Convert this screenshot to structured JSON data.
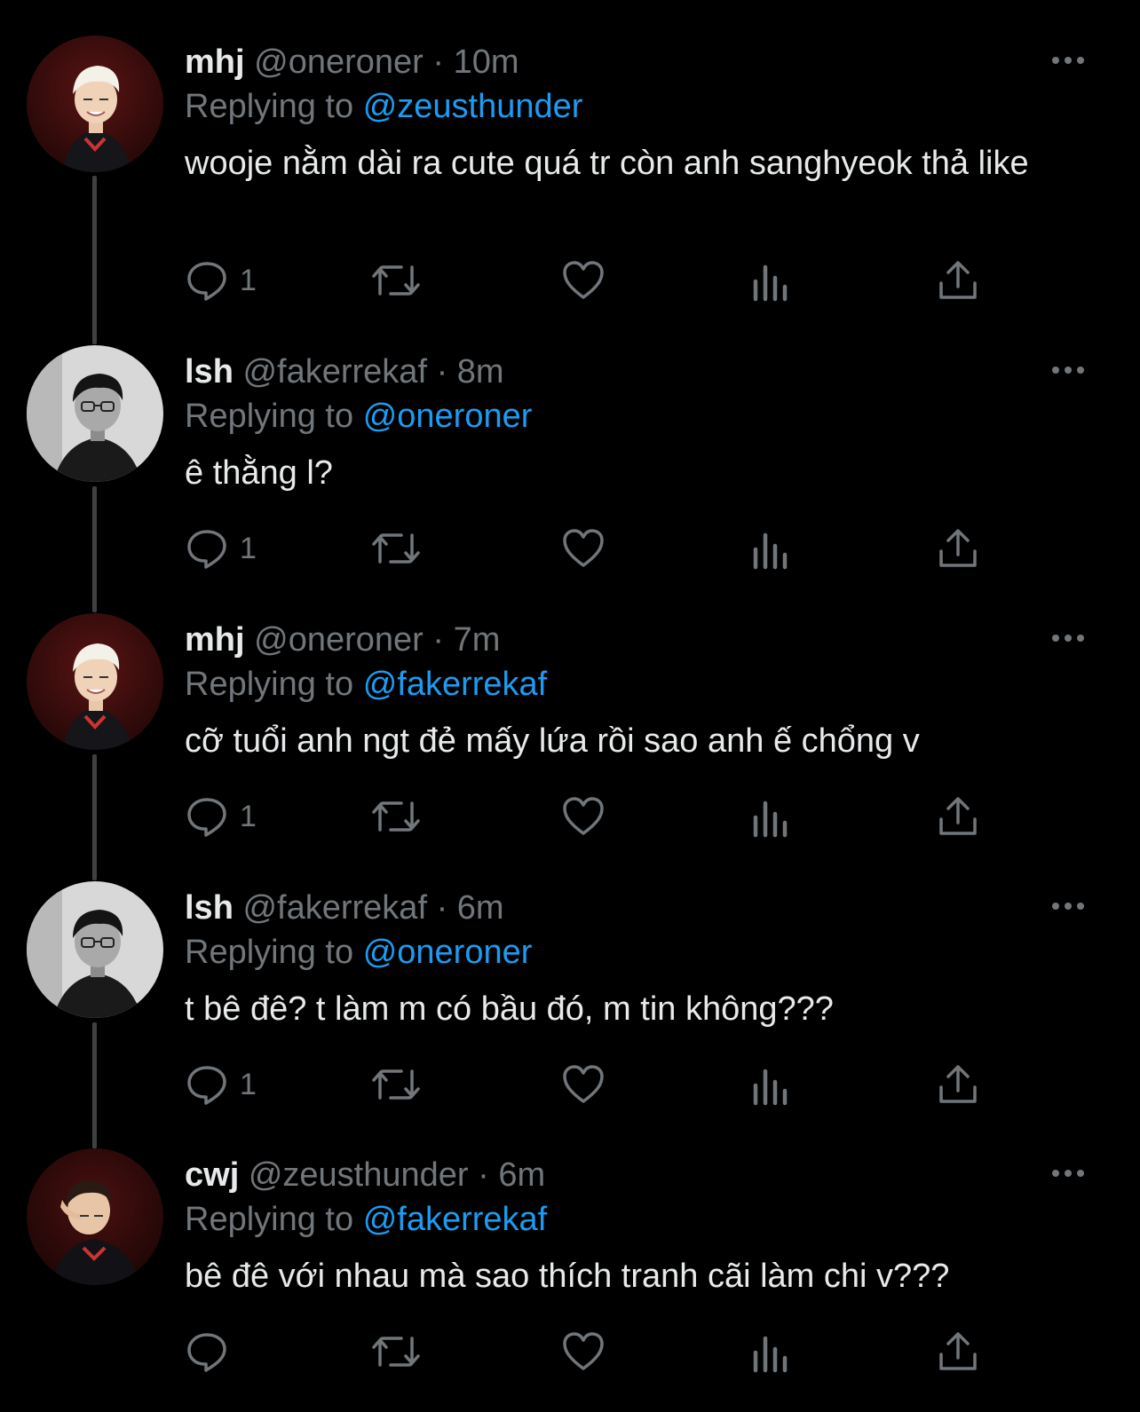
{
  "colors": {
    "background": "#000000",
    "text": "#e7e9ea",
    "muted": "#71767b",
    "link": "#1d9bf0",
    "thread_line": "#3e4144"
  },
  "reply_prefix": "Replying to",
  "tweets": [
    {
      "display_name": "mhj",
      "handle": "@oneroner",
      "time": "10m",
      "replying_to": "@zeusthunder",
      "text": "wooje nằm dài ra cute quá tr còn anh sanghyeok thả like",
      "reply_count": "1",
      "avatar": "avatar-mhj"
    },
    {
      "display_name": "lsh",
      "handle": "@fakerrekaf",
      "time": "8m",
      "replying_to": "@oneroner",
      "text": "ê thằng l?",
      "reply_count": "1",
      "avatar": "avatar-lsh"
    },
    {
      "display_name": "mhj",
      "handle": "@oneroner",
      "time": "7m",
      "replying_to": "@fakerrekaf",
      "text": "cỡ tuổi anh ngt đẻ mấy lứa rồi sao anh ế chổng v",
      "reply_count": "1",
      "avatar": "avatar-mhj"
    },
    {
      "display_name": "lsh",
      "handle": "@fakerrekaf",
      "time": "6m",
      "replying_to": "@oneroner",
      "text": "t bê đê? t làm m có bầu đó, m tin không???",
      "reply_count": "1",
      "avatar": "avatar-lsh"
    },
    {
      "display_name": "cwj",
      "handle": "@zeusthunder",
      "time": "6m",
      "replying_to": "@fakerrekaf",
      "text": "bê đê với nhau mà sao thích tranh cãi làm chi v???",
      "reply_count": "",
      "avatar": "avatar-cwj"
    }
  ],
  "action_icons": [
    "reply-icon",
    "retweet-icon",
    "like-icon",
    "views-icon",
    "share-icon"
  ]
}
